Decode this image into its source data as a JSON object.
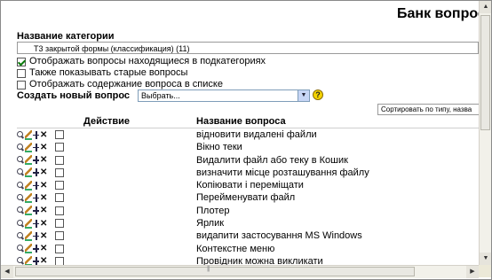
{
  "page": {
    "title": "Банк вопрос"
  },
  "category": {
    "label": "Название категории",
    "selected": "Т3 закрытой формы (классификация) (11)"
  },
  "options": [
    {
      "label": "Отображать вопросы находящиеся в подкатегориях",
      "checked": true
    },
    {
      "label": "Также показывать старые вопросы",
      "checked": false
    },
    {
      "label": "Отображать содержание вопроса в списке",
      "checked": false
    }
  ],
  "create": {
    "label": "Создать новый вопрос",
    "selected": "Выбрать...",
    "help_icon": "?"
  },
  "sort": {
    "selected": "Сортировать по типу, назва"
  },
  "table": {
    "col_action": "Действие",
    "col_name": "Название вопроса",
    "delete_glyph": "✕",
    "rows": [
      {
        "name": "відновити видалені файли"
      },
      {
        "name": "Вікно теки"
      },
      {
        "name": "Видалити файл або теку в Кошик"
      },
      {
        "name": "визначити місце розташування файлу"
      },
      {
        "name": "Копіювати і переміщати"
      },
      {
        "name": "Перейменувати файл"
      },
      {
        "name": "Плотер"
      },
      {
        "name": "Ярлик"
      },
      {
        "name": "видапити застосування MS Windows"
      },
      {
        "name": "Контекстне меню"
      },
      {
        "name": "Провідник можна викликати"
      }
    ]
  },
  "icons": {
    "preview": "magnifier-icon",
    "edit": "edit-icon",
    "move": "move-icon",
    "delete": "delete-icon",
    "checkmark_color": "#0a7a0a",
    "help_color": "#f5d400"
  }
}
